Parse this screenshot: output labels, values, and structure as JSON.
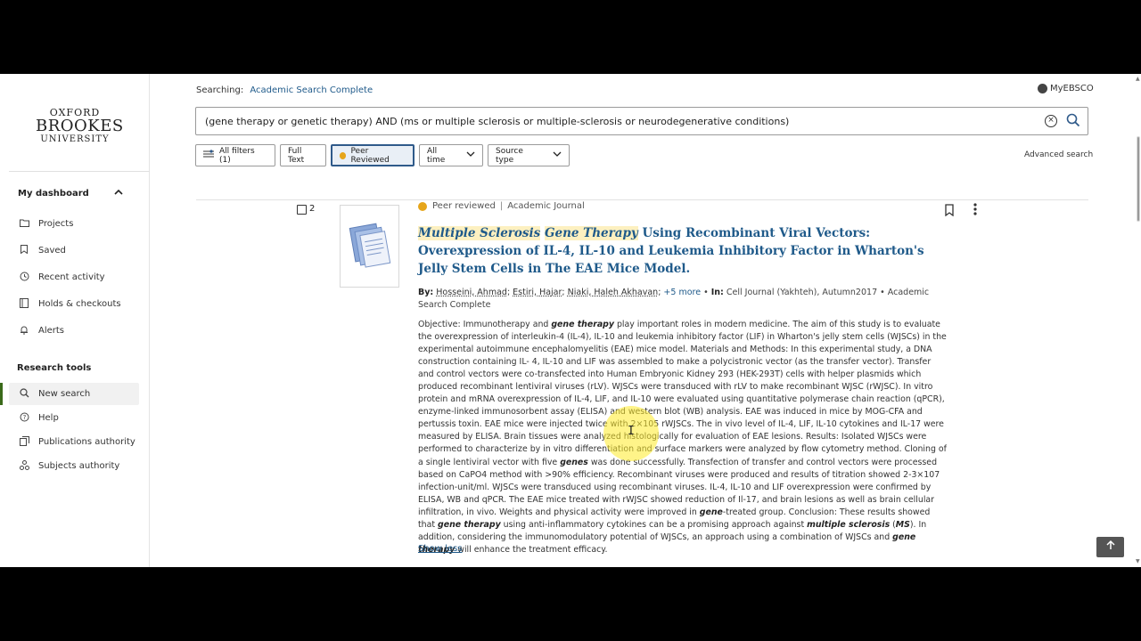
{
  "logo": {
    "line1": "OXFORD",
    "line2": "BROOKES",
    "line3": "UNIVERSITY"
  },
  "sidebar": {
    "dashboard_header": "My dashboard",
    "dashboard_items": [
      {
        "label": "Projects",
        "icon": "folder-icon"
      },
      {
        "label": "Saved",
        "icon": "bookmark-icon"
      },
      {
        "label": "Recent activity",
        "icon": "history-icon"
      },
      {
        "label": "Holds & checkouts",
        "icon": "book-icon"
      },
      {
        "label": "Alerts",
        "icon": "bell-icon"
      }
    ],
    "research_header": "Research tools",
    "research_items": [
      {
        "label": "New search",
        "icon": "search-icon",
        "active": true
      },
      {
        "label": "Help",
        "icon": "help-icon"
      },
      {
        "label": "Publications authority",
        "icon": "publications-icon"
      },
      {
        "label": "Subjects authority",
        "icon": "subjects-icon"
      }
    ]
  },
  "header": {
    "searching_label": "Searching:",
    "database": "Academic Search Complete",
    "account": "MyEBSCO"
  },
  "search": {
    "query": "(gene therapy or genetic therapy) AND (ms or multiple sclerosis or multiple-sclerosis or neurodegenerative conditions)"
  },
  "filters": {
    "all_filters": "All filters (1)",
    "full_text": "Full Text",
    "peer_reviewed": "Peer Reviewed",
    "all_time": "All time",
    "source_type": "Source type",
    "advanced": "Advanced search"
  },
  "result": {
    "number": "2",
    "peer_label": "Peer reviewed",
    "type": "Academic Journal",
    "title_hl1": "Multiple Sclerosis",
    "title_hl2": "Gene Therapy",
    "title_rest": " Using Recombinant Viral Vectors: Overexpression of IL-4, IL-10 and Leukemia Inhibitory Factor in Wharton's Jelly Stem Cells in The EAE Mice Model.",
    "by_label": "By:",
    "authors": [
      "Hosseini, Ahmad",
      "Estiri, Hajar",
      "Niaki, Haleh Akhavan"
    ],
    "more_authors": "+5 more",
    "in_label": "In:",
    "source": "Cell Journal (Yakhteh), Autumn2017",
    "database": "Academic Search Complete",
    "abstract_p1": "Objective: Immunotherapy and ",
    "abstract_em1": "gene therapy",
    "abstract_p2": " play important roles in modern medicine. The aim of this study is to evaluate the overexpression of interleukin-4 (IL-4), IL-10 and leukemia inhibitory factor (LIF) in Wharton's jelly stem cells (WJSCs) in the experimental autoimmune encephalomyelitis (EAE) mice model. Materials and Methods: In this experimental study, a DNA construction containing IL- 4, IL-10 and LIF was assembled to make a polycistronic vector (as the transfer vector). Transfer and control vectors were co-transfected into Human Embryonic Kidney 293 (HEK-293T) cells with helper plasmids which produced recombinant lentiviral viruses (rLV). WJSCs were transduced with rLV to make recombinant WJSC (rWJSC). In vitro protein and mRNA overexpression of IL-4, LIF, and IL-10 were evaluated using quantitative polymerase chain reaction (qPCR), enzyme-linked immunosorbent assay (ELISA) and western blot (WB) analysis. EAE was induced in mice by MOG-CFA and pertussis toxin. EAE mice were injected twice with 2×105 rWJSCs. The in vivo level of IL-4, LIF, IL-10 cytokines and IL-17 were measured by ELISA. Brain tissues were analyzed histologically for evaluation of EAE lesions. Results: Isolated WJSCs were performed to characterize by in vitro differentiation and surface markers were analyzed by flow cytometry method. Cloning of a single lentiviral vector with five ",
    "abstract_em2": "genes",
    "abstract_p3": " was done successfully. Transfection of transfer and control vectors were processed based on CaPO4 method with >90% efficiency. Recombinant viruses were produced and results of titration showed 2-3×107 infection-unit/ml. WJSCs were transduced using recombinant viruses. IL-4, IL-10 and LIF overexpression were confirmed by ELISA, WB and qPCR. The EAE mice treated with rWJSC showed reduction of Il-17, and brain lesions as well as brain cellular infiltration, in vivo. Weights and physical activity were improved in ",
    "abstract_em3": "gene",
    "abstract_p4": "-treated group. Conclusion: These results showed that ",
    "abstract_em4": "gene therapy",
    "abstract_p5": " using anti-inflammatory cytokines can be a promising approach against ",
    "abstract_em5": "multiple sclerosis",
    "abstract_p6": " (",
    "abstract_em6": "MS",
    "abstract_p7": "). In addition, considering the immunomodulatory potential of WJSCs, an approach using a combination of WJSCs and ",
    "abstract_em7": "gene therapy",
    "abstract_p8": " will enhance the treatment efficacy.",
    "show_less": "Show less"
  },
  "colors": {
    "link": "#1f5a8a",
    "peer_badge": "#e6a51a",
    "highlight": "#fdf0c0",
    "active_bar": "#3a6a1a"
  },
  "scroll_top_icon": "arrow-up-icon"
}
